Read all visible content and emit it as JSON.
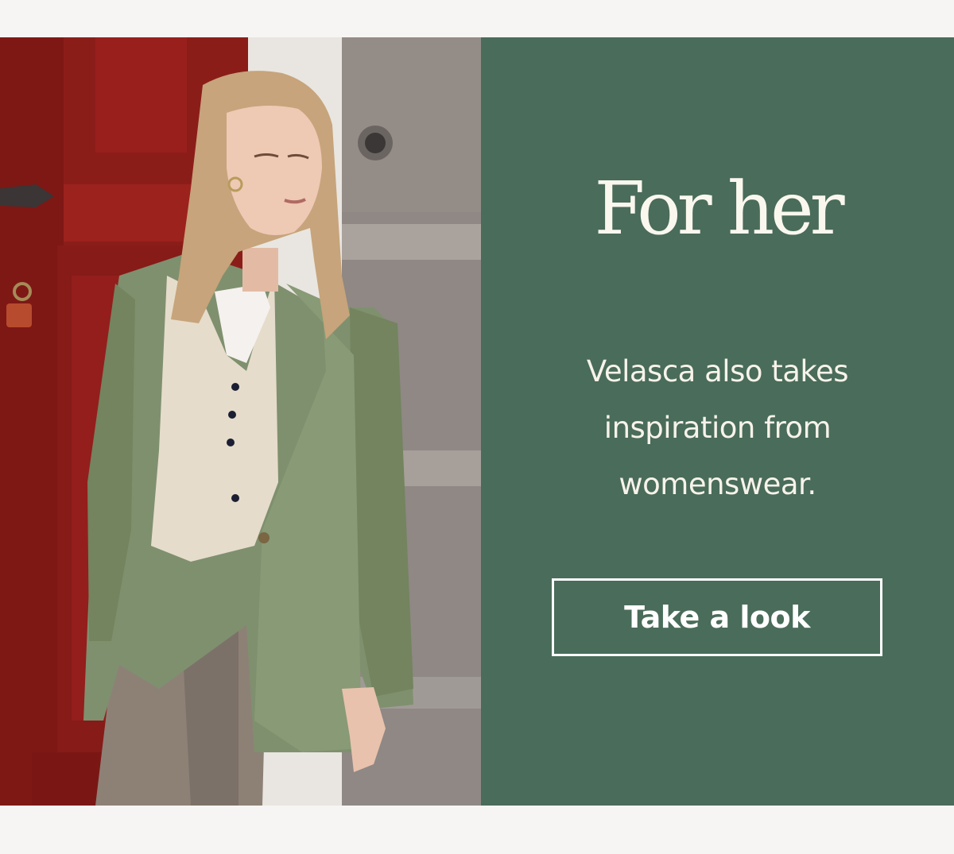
{
  "promo": {
    "headline": "For her",
    "body_lines": [
      "Velasca also takes",
      "inspiration from",
      "womenswear."
    ],
    "cta_label": "Take a look"
  },
  "colors": {
    "page_background": "#f7f5f4",
    "panel_background": "#4a6c5a",
    "text": "#f7f3ea",
    "button_border": "#ffffff"
  },
  "icons": {
    "hero": "hero-photo"
  }
}
